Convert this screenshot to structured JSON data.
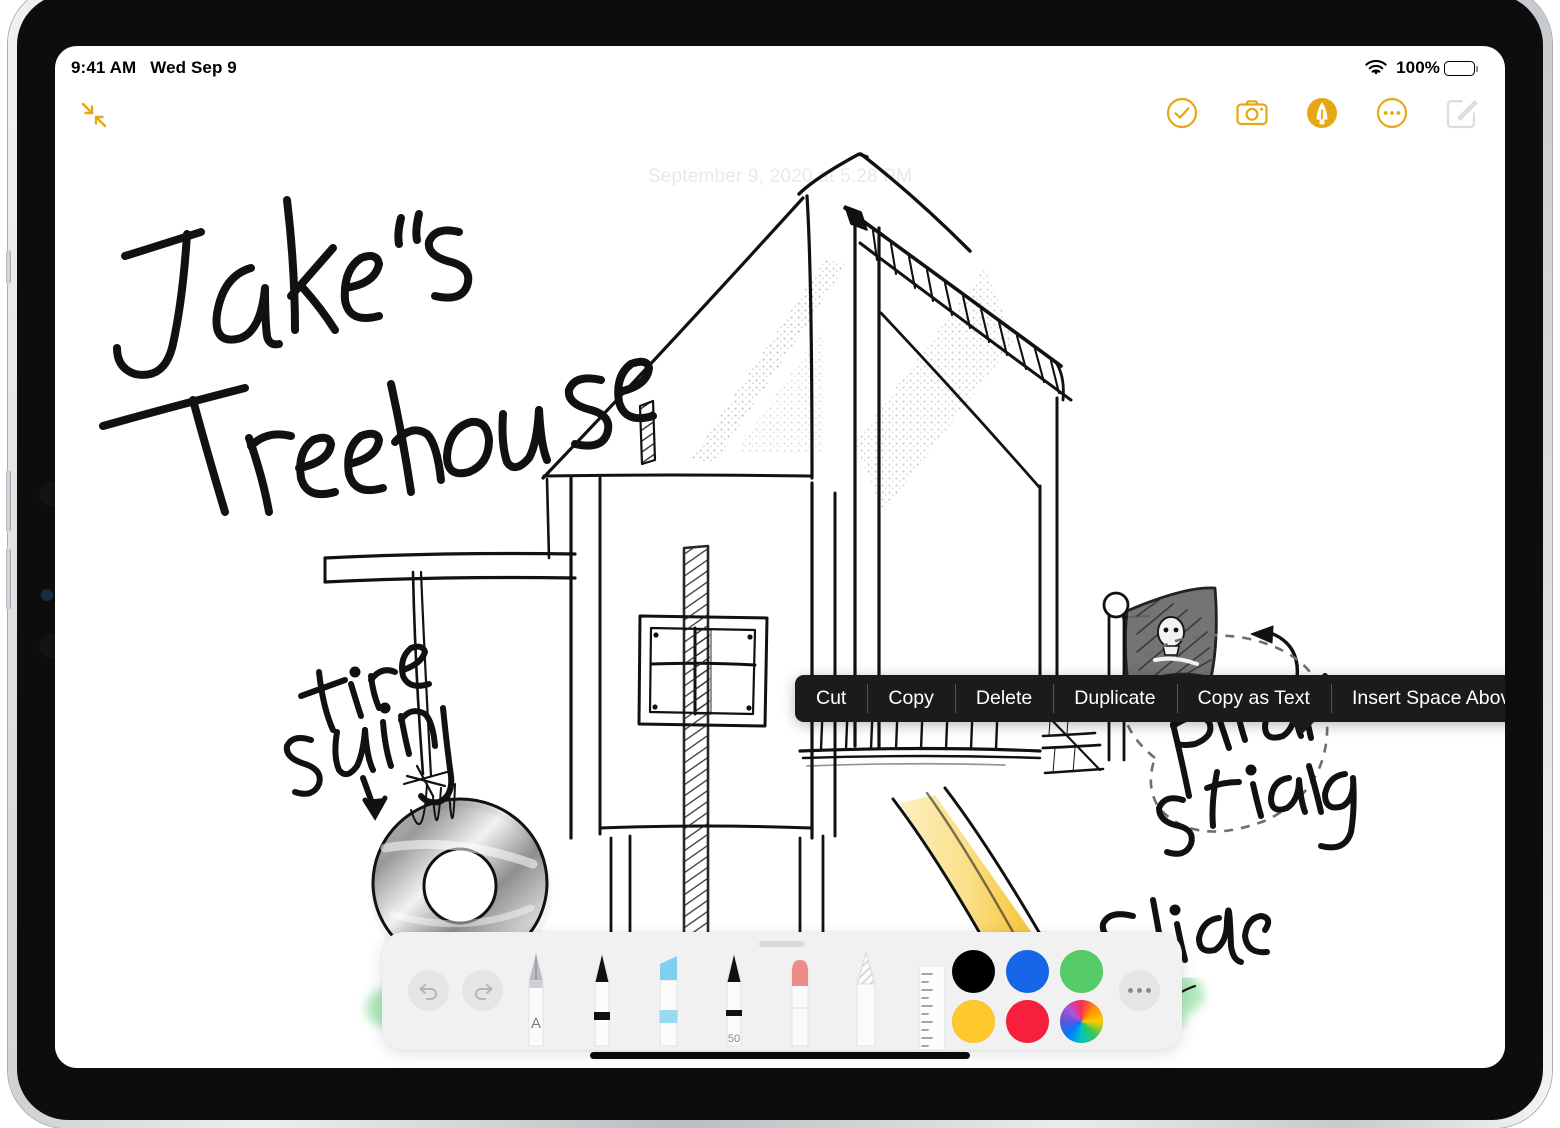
{
  "status_bar": {
    "time": "9:41 AM",
    "date": "Wed Sep 9",
    "wifi_icon": "wifi-icon",
    "battery_percent": "100%",
    "battery_icon": "battery-full-icon"
  },
  "note_toolbar": {
    "collapse_icon": "collapse-arrows-icon",
    "actions": [
      {
        "name": "checklist-button",
        "icon": "check-circle-icon",
        "label": "Checklist"
      },
      {
        "name": "camera-button",
        "icon": "camera-icon",
        "label": "Camera"
      },
      {
        "name": "markup-button",
        "icon": "markup-pen-icon",
        "label": "Markup",
        "active": true
      },
      {
        "name": "more-button",
        "icon": "ellipsis-circle-icon",
        "label": "More"
      },
      {
        "name": "compose-button",
        "icon": "compose-icon",
        "label": "New Note",
        "disabled": true
      }
    ]
  },
  "note": {
    "date_label": "September 9, 2020 at 5:28 PM",
    "title_handwritten": "Jake's Treehouse",
    "annotations": [
      {
        "text": "tire swing",
        "name": "annotation-tire-swing"
      },
      {
        "text": "Pirate flag",
        "name": "annotation-pirate-flag",
        "selected": true
      },
      {
        "text": "Slide",
        "name": "annotation-slide"
      }
    ]
  },
  "context_menu": {
    "items": [
      {
        "label": "Cut",
        "name": "context-menu-cut"
      },
      {
        "label": "Copy",
        "name": "context-menu-copy"
      },
      {
        "label": "Delete",
        "name": "context-menu-delete"
      },
      {
        "label": "Duplicate",
        "name": "context-menu-duplicate"
      },
      {
        "label": "Copy as Text",
        "name": "context-menu-copy-as-text"
      },
      {
        "label": "Insert Space Above",
        "name": "context-menu-insert-space-above"
      }
    ]
  },
  "tool_palette": {
    "undo_icon": "undo-arrow-icon",
    "redo_icon": "redo-arrow-icon",
    "grabber": "palette-grabber",
    "more_icon": "ellipsis-icon",
    "tools": [
      {
        "name": "tool-scribble-pen",
        "label": "A",
        "icon": "handwriting-pen-icon"
      },
      {
        "name": "tool-pen",
        "label": "",
        "icon": "pen-icon"
      },
      {
        "name": "tool-highlighter",
        "label": "",
        "icon": "highlighter-icon"
      },
      {
        "name": "tool-marker",
        "label": "50",
        "icon": "marker-icon"
      },
      {
        "name": "tool-eraser",
        "label": "",
        "icon": "eraser-icon"
      },
      {
        "name": "tool-lasso",
        "label": "",
        "icon": "lasso-select-icon"
      },
      {
        "name": "tool-ruler",
        "label": "",
        "icon": "ruler-icon"
      }
    ],
    "colors": [
      {
        "name": "color-black",
        "hex": "#000000"
      },
      {
        "name": "color-blue",
        "hex": "#1667E8"
      },
      {
        "name": "color-green",
        "hex": "#55CC65"
      },
      {
        "name": "color-yellow",
        "hex": "#FFC92E"
      },
      {
        "name": "color-red",
        "hex": "#F81F3C"
      },
      {
        "name": "color-picker",
        "hex": "rainbow"
      }
    ]
  },
  "theme": {
    "accent": "#E5A812",
    "menu_bg": "#1B1B1D",
    "palette_bg": "#F1F1F2",
    "date_text": "#E9E9EA"
  },
  "home_indicator": "home-indicator"
}
